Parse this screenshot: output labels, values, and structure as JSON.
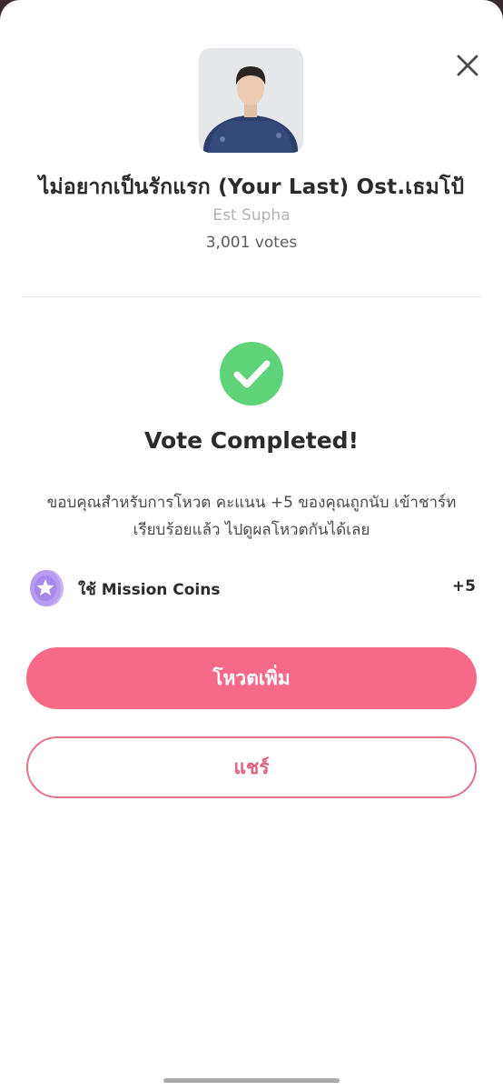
{
  "song": {
    "title": "ไม่อยากเป็นรักแรก (Your Last) Ost.เธมโป้",
    "artist": "Est Supha",
    "votes": "3,001 votes"
  },
  "status": {
    "title": "Vote Completed!",
    "message": "ขอบคุณสำหรับการโหวต คะแนน +5 ของคุณถูกนับ เข้าชาร์ท เรียบร้อยแล้ว ไปดูผลโหวตกันได้เลย"
  },
  "coins": {
    "label": "ใช้ Mission Coins",
    "value": "+5"
  },
  "buttons": {
    "vote_more": "โหวตเพิ่ม",
    "share": "แชร์"
  },
  "icons": {
    "close": "close-icon",
    "check": "check-circle-icon",
    "coin": "star-coin-icon"
  },
  "colors": {
    "primary": "#f66a88",
    "success": "#5fd37a",
    "coin": "#b79cf2"
  }
}
